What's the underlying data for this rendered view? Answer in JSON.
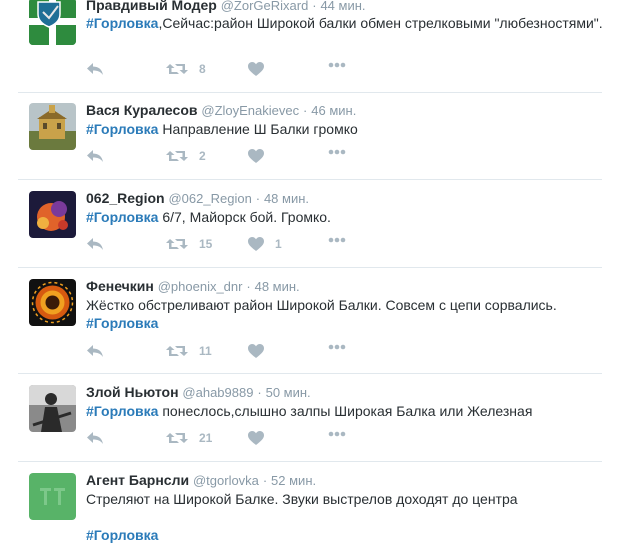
{
  "tweets": [
    {
      "name": "Правдивый Модер",
      "handle": "@ZorGeRixard",
      "time": "44 мин.",
      "hashtag": "#Горловка",
      "text": ",Сейчас:район Широкой балки обмен стрелковыми \"любезностями\".",
      "retweets": "8",
      "likes": "",
      "avatar": {
        "colors": [
          "#2e8b3e",
          "#ffffff",
          "#1f6f96"
        ]
      }
    },
    {
      "name": "Вася Куралесов",
      "handle": "@ZloyEnakievec",
      "time": "46 мин.",
      "hashtag": "#Горловка",
      "text": " Направление Ш Балки громко",
      "retweets": "2",
      "likes": "",
      "avatar": {
        "colors": [
          "#c9a24a",
          "#6b7a3e",
          "#b8c4c8"
        ]
      }
    },
    {
      "name": "062_Region",
      "handle": "@062_Region",
      "time": "48 мин.",
      "hashtag": "#Горловка",
      "text": " 6/7, Майорск бой. Громко.",
      "retweets": "15",
      "likes": "1",
      "avatar": {
        "colors": [
          "#1c1a3a",
          "#e0632a",
          "#7a3a9a"
        ]
      }
    },
    {
      "name": "Фенечкин",
      "handle": "@phoenix_dnr",
      "time": "48 мин.",
      "hashtag": "#Горловка",
      "text": "Жёстко обстреливают район Широкой Балки. Совсем с цепи сорвались.",
      "retweets": "11",
      "likes": "",
      "avatar": {
        "colors": [
          "#111111",
          "#f0a020",
          "#d65a10"
        ]
      }
    },
    {
      "name": "Злой Ньютон",
      "handle": "@ahab9889",
      "time": "50 мин.",
      "hashtag": "#Горловка",
      "text": " понеслось,слышно залпы Широкая Балка или Железная",
      "retweets": "21",
      "likes": "",
      "avatar": {
        "colors": [
          "#2a2a2a",
          "#8a8a8a",
          "#d8d8d8"
        ]
      }
    },
    {
      "name": "Агент Барнсли",
      "handle": "@tgorlovka",
      "time": "52 мин.",
      "hashtag": "#Горловка",
      "text": "Стреляют на Широкой Балке. Звуки выстрелов доходят до центра",
      "retweets": "",
      "likes": "",
      "avatar": {
        "colors": [
          "#58b368",
          "#7dc88a",
          "#ffffff"
        ]
      }
    }
  ],
  "icons": [
    "reply-icon",
    "retweet-icon",
    "like-icon",
    "more-icon"
  ],
  "colors": {
    "hashtag": "#2b7bb9",
    "meta": "#8899a6",
    "action": "#aab8c2",
    "divider": "#e1e8ed"
  }
}
